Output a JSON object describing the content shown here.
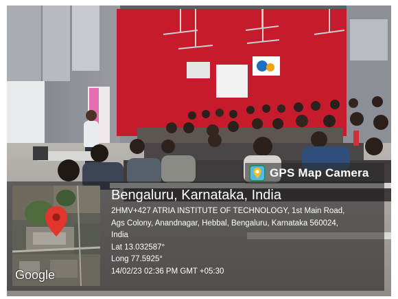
{
  "stamp": {
    "brand": "GPS Map Camera",
    "city": "Bengaluru, Karnataka, India",
    "address_line1": "2HMV+427 ATRIA INSTITUTE OF TECHNOLOGY, 1st Main Road,",
    "address_line2": "Ags Colony, Anandnagar, Hebbal, Bengaluru, Karnataka 560024,",
    "address_line3": "India",
    "lat": "Lat 13.032587°",
    "long": "Long 77.5925°",
    "datetime": "14/02/23 02:36 PM GMT +05:30",
    "map_logo": "Google"
  }
}
